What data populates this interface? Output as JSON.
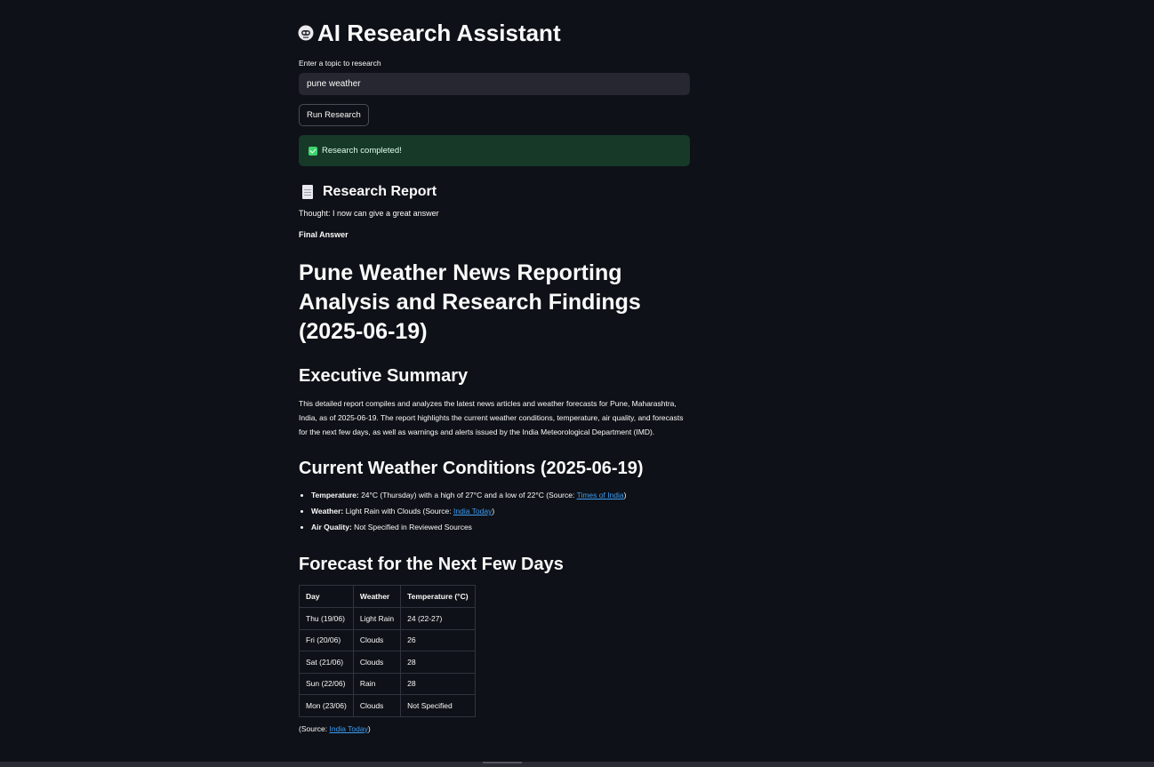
{
  "app": {
    "title": "AI Research Assistant",
    "icon": "robot-face-icon"
  },
  "input": {
    "label": "Enter a topic to research",
    "value": "pune weather",
    "placeholder": ""
  },
  "run_button": {
    "label": "Run Research"
  },
  "status": {
    "message": "Research completed!",
    "icon": "check-box-icon",
    "color": "#173928"
  },
  "report": {
    "heading": "Research Report",
    "heading_icon": "document-icon",
    "thought": "Thought: I now can give a great answer",
    "final_answer_label": "Final Answer",
    "title": "Pune Weather News Reporting Analysis and Research Findings (2025-06-19)",
    "executive_summary": {
      "heading": "Executive Summary",
      "text": "This detailed report compiles and analyzes the latest news articles and weather forecasts for Pune, Maharashtra, India, as of 2025-06-19. The report highlights the current weather conditions, temperature, air quality, and forecasts for the next few days, as well as warnings and alerts issued by the India Meteorological Department (IMD)."
    },
    "current_conditions": {
      "heading": "Current Weather Conditions (2025-06-19)",
      "items": [
        {
          "label": "Temperature:",
          "text_before": " 24°C (Thursday) with a high of 27°C and a low of 22°C (Source: ",
          "link": "Times of India",
          "text_after": ")"
        },
        {
          "label": "Weather:",
          "text_before": " Light Rain with Clouds (Source: ",
          "link": "India Today",
          "text_after": ")"
        },
        {
          "label": "Air Quality:",
          "text_before": " Not Specified in Reviewed Sources",
          "link": "",
          "text_after": ""
        }
      ]
    },
    "forecast": {
      "heading": "Forecast for the Next Few Days",
      "columns": [
        "Day",
        "Weather",
        "Temperature (°C)"
      ],
      "rows": [
        [
          "Thu (19/06)",
          "Light Rain",
          "24 (22-27)"
        ],
        [
          "Fri (20/06)",
          "Clouds",
          "26"
        ],
        [
          "Sat (21/06)",
          "Clouds",
          "28"
        ],
        [
          "Sun (22/06)",
          "Rain",
          "28"
        ],
        [
          "Mon (23/06)",
          "Clouds",
          "Not Specified"
        ]
      ],
      "source_prefix": "(Source: ",
      "source_link": "India Today",
      "source_suffix": ")"
    }
  },
  "colors": {
    "background": "#0e1117",
    "link": "#3d9df3",
    "success_bg": "#173928"
  }
}
